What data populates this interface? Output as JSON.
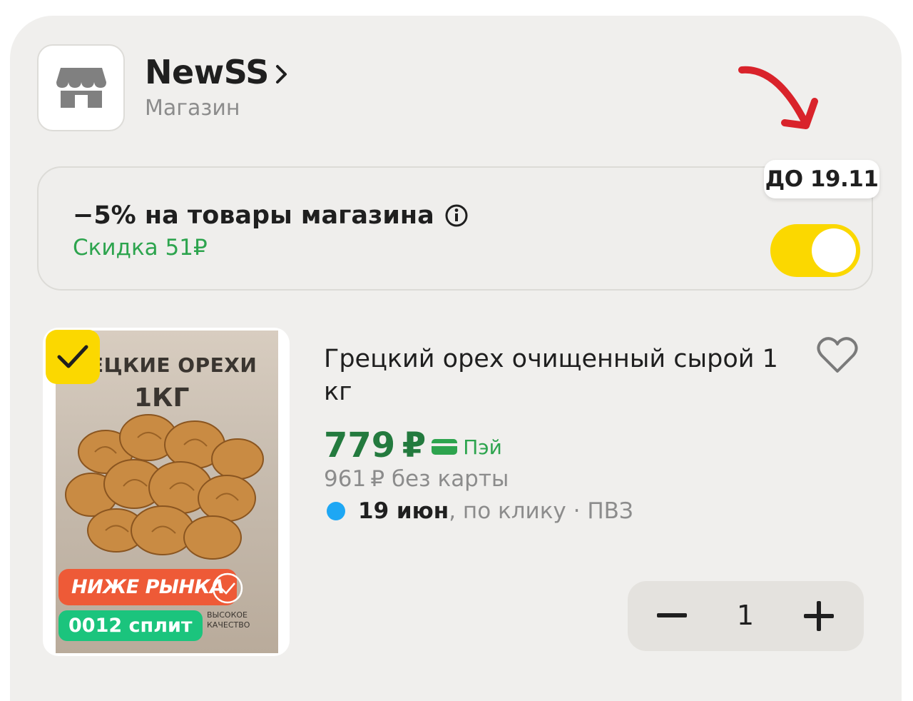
{
  "store": {
    "name": "NewSS",
    "subtitle": "Магазин",
    "icon": "store-awning-icon"
  },
  "promo": {
    "title": "−5% на товары магазина",
    "discount": "Скидка 51₽",
    "deadline": "ДО 19.11",
    "toggle_on": true,
    "accent_color": "#fbd800",
    "discount_color": "#2da44e"
  },
  "product": {
    "title": "Грецкий орех очищенный сырой 1 кг",
    "price": "779 ₽",
    "pay_label": "Пэй",
    "price_old": "961 ₽  без карты",
    "delivery_date": "19 июн",
    "delivery_rest": ", по клику · ПВЗ",
    "selected": true,
    "image": {
      "heading": "ЕЦКИЕ ОРЕХИ",
      "subheading": "1КГ",
      "badge_below": "НИЖЕ РЫНКА",
      "badge_split": "0012 сплит",
      "quality": "ВЫСОКОЕ КАЧЕСТВО"
    },
    "price_color": "#237a3e"
  },
  "quantity": {
    "value": "1"
  }
}
